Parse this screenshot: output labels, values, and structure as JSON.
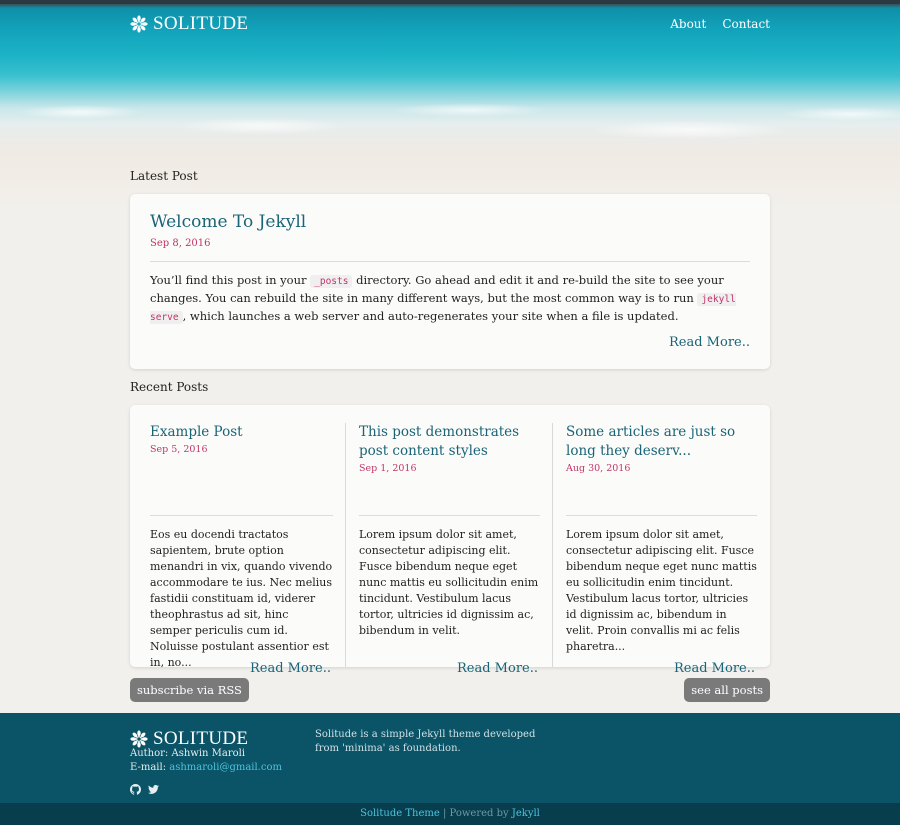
{
  "site": {
    "brand": "SOLITUDE",
    "nav": [
      "About",
      "Contact"
    ]
  },
  "latest": {
    "heading": "Latest Post",
    "title": "Welcome To Jekyll",
    "date": "Sep 8, 2016",
    "body_part1": "You’ll find this post in your ",
    "code1": "_posts",
    "body_part2": " directory. Go ahead and edit it and re-build the site to see your changes. You can rebuild the site in many different ways, but the most common way is to run ",
    "code2": "jekyll serve",
    "body_part3": ", which launches a web server and auto-regenerates your site when a file is updated.",
    "read_more": "Read More.."
  },
  "recent": {
    "heading": "Recent Posts",
    "posts": [
      {
        "title": "Example Post",
        "date": "Sep 5, 2016",
        "body": "Eos eu docendi tractatos sapientem, brute option menandri in vix, quando vivendo accommodare te ius. Nec melius fastidii constituam id, viderer theophrastus ad sit, hinc semper periculis cum id. Noluisse postulant assentior est in, no...",
        "read_more": "Read More.."
      },
      {
        "title": "This post demonstrates post content styles",
        "date": "Sep 1, 2016",
        "body": "Lorem ipsum dolor sit amet, consectetur adipiscing elit. Fusce bibendum neque eget nunc mattis eu sollicitudin enim tincidunt. Vestibulum lacus tortor, ultricies id dignissim ac, bibendum in velit.",
        "read_more": "Read More.."
      },
      {
        "title": "Some articles are just so long they deserv...",
        "date": "Aug 30, 2016",
        "body": "Lorem ipsum dolor sit amet, consectetur adipiscing elit. Fusce bibendum neque eget nunc mattis eu sollicitudin enim tincidunt. Vestibulum lacus tortor, ultricies id dignissim ac, bibendum in velit. Proin convallis mi ac felis pharetra...",
        "read_more": "Read More.."
      }
    ]
  },
  "buttons": {
    "rss": "subscribe via RSS",
    "all_posts": "see all posts"
  },
  "footer": {
    "brand": "SOLITUDE",
    "author": "Author: Ashwin Maroli",
    "email_label": "E-mail: ",
    "email": "ashmaroli@gmail.com",
    "social_icons": [
      "github-icon",
      "twitter-icon"
    ],
    "description": "Solitude is a simple Jekyll theme developed from 'minima' as foundation.",
    "bottom_theme": "Solitude Theme",
    "bottom_sep": " | Powered by ",
    "bottom_jekyll": "Jekyll"
  },
  "colors": {
    "accent": "#1a6477",
    "date": "#c0356a",
    "footer_bg": "#0b5366",
    "bottom_bg": "#073d4c",
    "link": "#4ec3dd"
  }
}
